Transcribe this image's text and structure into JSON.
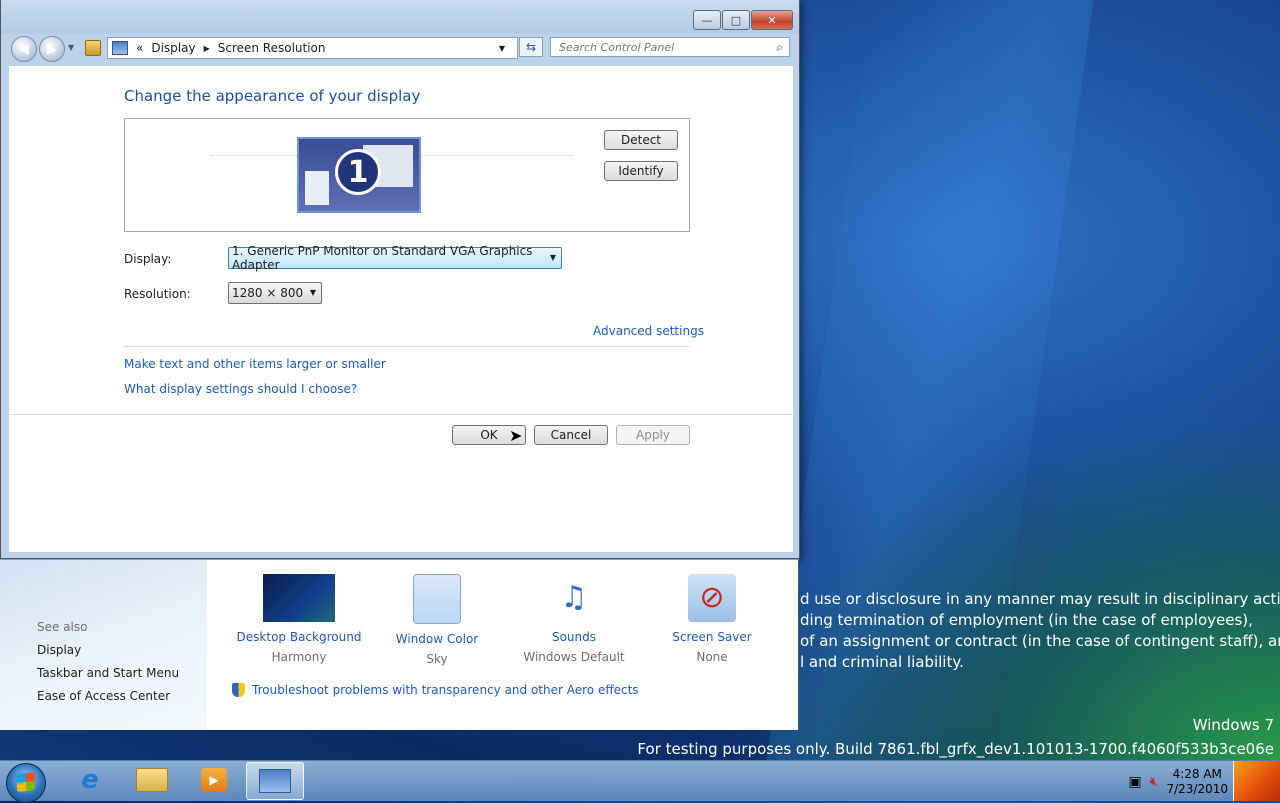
{
  "window": {
    "nav": {
      "back_icon": "back-arrow-icon",
      "forward_icon": "forward-arrow-icon"
    },
    "address": {
      "prefix": "«",
      "crumbs": [
        "Display",
        "Screen Resolution"
      ]
    },
    "search": {
      "placeholder": "Search Control Panel"
    },
    "controls": {
      "minimize": "—",
      "maximize": "□",
      "close": "✕"
    }
  },
  "screen_resolution": {
    "heading": "Change the appearance of your display",
    "monitor_number": "1",
    "detect_label": "Detect",
    "identify_label": "Identify",
    "display_label": "Display:",
    "display_value": "1. Generic PnP Monitor on Standard VGA Graphics Adapter",
    "resolution_label": "Resolution:",
    "resolution_value": "1280 × 800",
    "advanced_link": "Advanced settings",
    "link_text_size": "Make text and other items larger or smaller",
    "link_help": "What display settings should I choose?",
    "ok_label": "OK",
    "cancel_label": "Cancel",
    "apply_label": "Apply"
  },
  "personalization": {
    "see_also": "See also",
    "see_also_links": [
      "Display",
      "Taskbar and Start Menu",
      "Ease of Access Center"
    ],
    "items": [
      {
        "title": "Desktop Background",
        "subtitle": "Harmony"
      },
      {
        "title": "Window Color",
        "subtitle": "Sky"
      },
      {
        "title": "Sounds",
        "subtitle": "Windows Default"
      },
      {
        "title": "Screen Saver",
        "subtitle": "None"
      }
    ],
    "troubleshoot_link": "Troubleshoot problems with transparency and other Aero effects"
  },
  "desktop": {
    "notice_lines": [
      "d use or disclosure in any manner may result in disciplinary action up",
      "ding termination of employment (in the case of employees),",
      "of an assignment or contract (in the case of contingent staff), and",
      "l and criminal liability."
    ],
    "os_name": "Windows 7",
    "build_text": "For testing purposes only. Build 7861.fbl_grfx_dev1.101013-1700.f4060f533b3ce06e"
  },
  "taskbar": {
    "time": "4:28 AM",
    "date": "7/23/2010"
  }
}
